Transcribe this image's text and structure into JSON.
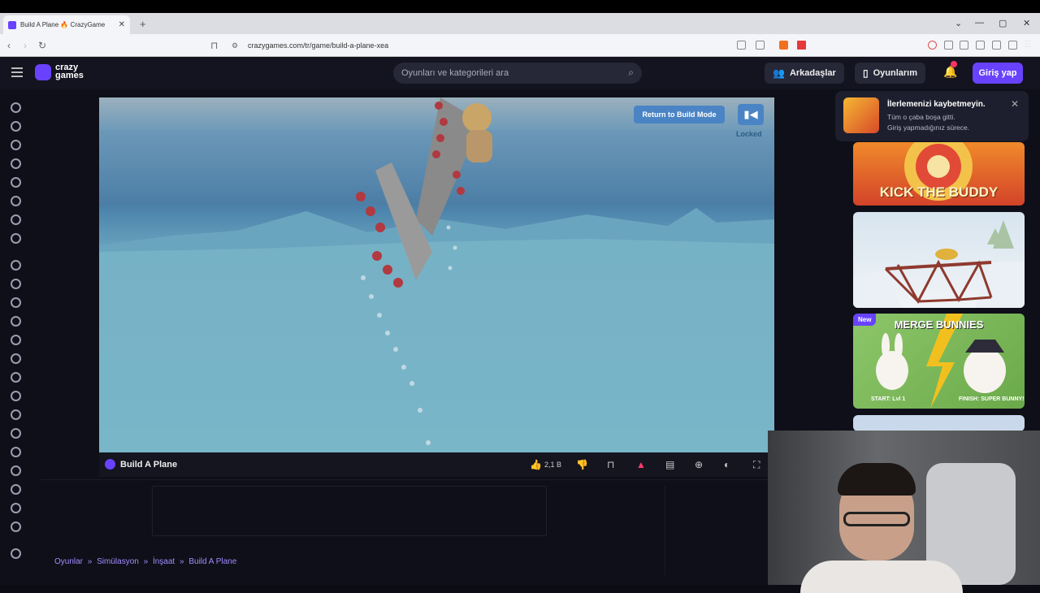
{
  "browser": {
    "tab_title": "Build A Plane 🔥 CrazyGame",
    "url": "crazygames.com/tr/game/build-a-plane-xea"
  },
  "header": {
    "logo_line1": "crazy",
    "logo_line2": "games",
    "search_placeholder": "Oyunları ve kategorileri ara",
    "friends_label": "Arkadaşlar",
    "my_games_label": "Oyunlarım",
    "notification_count": "1",
    "login_label": "Giriş yap"
  },
  "game": {
    "return_button": "Return to Build Mode",
    "locked_label": "Locked",
    "title": "Build A Plane",
    "likes": "2,1 B"
  },
  "toast": {
    "heading": "İlerlemenizi kaybetmeyin.",
    "line1": "Tüm o çaba boşa gitti.",
    "line2": "Giriş yapmadığınız sürece."
  },
  "cards": [
    {
      "title": "KICK THE BUDDY"
    },
    {
      "title": ""
    },
    {
      "title": "MERGE BUNNIES",
      "badge": "New",
      "start": "START: Lvl 1",
      "finish": "FINISH: SUPER BUNNY!"
    }
  ],
  "breadcrumb": [
    "Oyunlar",
    "»",
    "Simülasyon",
    "»",
    "İnşaat",
    "»",
    "Build A Plane"
  ],
  "colors": {
    "accent": "#6842ff",
    "game_button": "#4b84c5",
    "breadcrumb": "#a48cff"
  }
}
